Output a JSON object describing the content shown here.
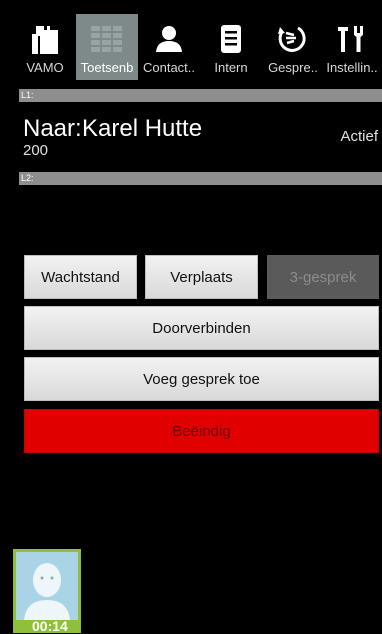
{
  "tabs": [
    {
      "label": "VAMO",
      "icon": "vamo-icon"
    },
    {
      "label": "Toetsenb",
      "icon": "keypad-icon"
    },
    {
      "label": "Contact..",
      "icon": "contact-icon"
    },
    {
      "label": "Intern",
      "icon": "intern-list-icon"
    },
    {
      "label": "Gespre..",
      "icon": "call-history-icon"
    },
    {
      "label": "Instellin..",
      "icon": "settings-tools-icon"
    }
  ],
  "lines": {
    "l1": "L1:",
    "l2": "L2:"
  },
  "call": {
    "prefix": "Naar:",
    "name": "Karel Hutte",
    "number": "200",
    "status": "Actief"
  },
  "buttons": {
    "hold": "Wachtstand",
    "move": "Verplaats",
    "conference": "3-gesprek",
    "transfer": "Doorverbinden",
    "add_call": "Voeg gesprek toe",
    "end": "Beëindig"
  },
  "footer": {
    "timer": "00:14"
  },
  "colors": {
    "end_button": "#e00000",
    "active_tab": "#7e8a8a",
    "avatar_frame": "#8fc03b"
  }
}
